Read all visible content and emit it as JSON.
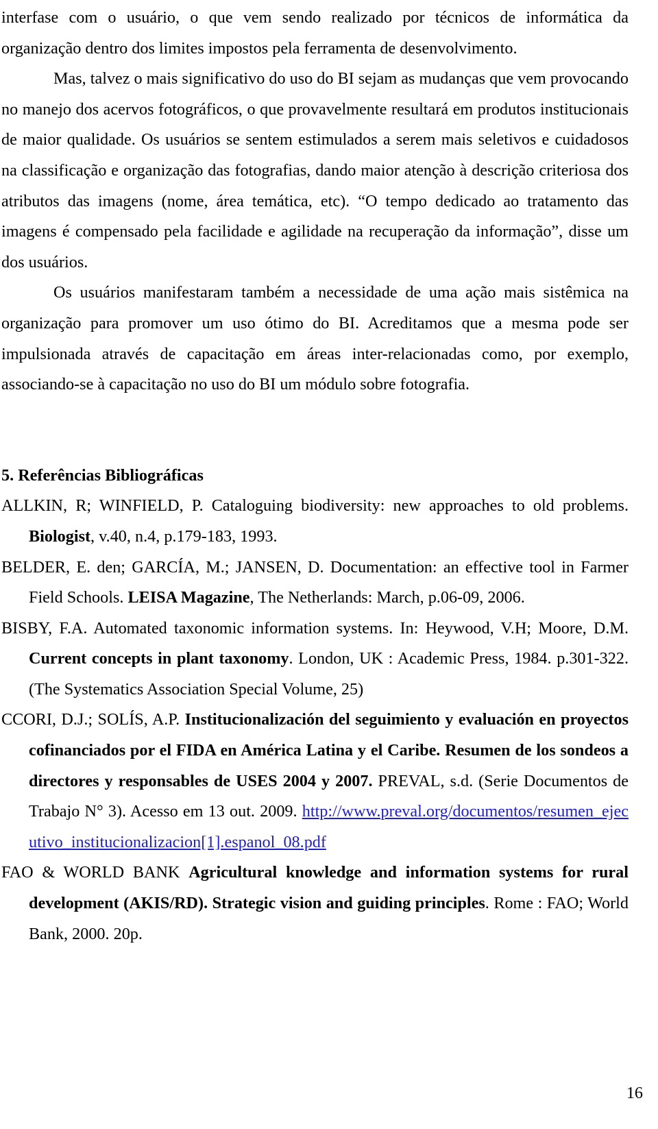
{
  "document": {
    "page_number": "16",
    "link_color": "#2020C8",
    "text_color": "#000000",
    "background_color": "#ffffff"
  },
  "body": {
    "paragraphs": [
      {
        "id": "p-interfase",
        "indent": false,
        "text": "interfase com o usuário, o que vem sendo realizado por técnicos de informática da organização dentro dos limites impostos pela ferramenta de desenvolvimento."
      },
      {
        "id": "p-mas-talvez",
        "indent": true,
        "text": "Mas, talvez o mais significativo do uso do BI sejam as mudanças que vem provocando no manejo dos acervos fotográficos, o que provavelmente resultará em produtos institucionais de maior qualidade. Os usuários se sentem estimulados a serem mais seletivos e cuidadosos na classificação e organização das fotografias, dando maior atenção à descrição criteriosa dos atributos das imagens (nome, área temática, etc). “O tempo dedicado ao tratamento das imagens é compensado pela facilidade e agilidade na recuperação da informação”, disse um dos usuários."
      },
      {
        "id": "p-os-usuarios",
        "indent": true,
        "text": "Os usuários manifestaram também a necessidade de uma ação mais sistêmica na organização para promover um uso ótimo do BI. Acreditamos que a mesma pode ser impulsionada através de capacitação em áreas inter-relacionadas como, por exemplo, associando-se à capacitação no uso do BI um módulo sobre fotografia."
      }
    ]
  },
  "references_section": {
    "heading": "5. Referências Bibliográficas",
    "entries": [
      {
        "id": "ref-allkin",
        "parts": [
          {
            "text": "ALLKIN, R; WINFIELD, P.   Cataloguing biodiversity: new approaches to old problems. ",
            "style": "normal"
          },
          {
            "text": "Biologist",
            "style": "bold"
          },
          {
            "text": ", v.40, n.4, p.179-183, 1993.",
            "style": "normal"
          }
        ]
      },
      {
        "id": "ref-belder",
        "parts": [
          {
            "text": "BELDER, E. den; GARCÍA, M.; JANSEN, D.   Documentation: an effective tool in Farmer Field Schools. ",
            "style": "normal"
          },
          {
            "text": "LEISA Magazine",
            "style": "bold"
          },
          {
            "text": ", The Netherlands: March, p.06-09, 2006.",
            "style": "normal"
          }
        ]
      },
      {
        "id": "ref-bisby",
        "parts": [
          {
            "text": "BISBY, F.A.   Automated taxonomic information systems. In: Heywood, V.H; Moore, D.M.  ",
            "style": "normal"
          },
          {
            "text": "Current concepts in plant taxonomy",
            "style": "bold"
          },
          {
            "text": ". London, UK : Academic Press, 1984. p.301-322. (The Systematics Association Special Volume, 25)",
            "style": "normal"
          }
        ]
      },
      {
        "id": "ref-ccori",
        "parts": [
          {
            "text": "CCORI, D.J.; SOLÍS, A.P.   ",
            "style": "normal"
          },
          {
            "text": "Institucionalización del seguimiento y evaluación en proyectos cofinanciados por el FIDA en América Latina y el Caribe. Resumen de los sondeos a directores y responsables de USES 2004 y 2007.",
            "style": "bold"
          },
          {
            "text": " PREVAL, s.d. (Serie Documentos de Trabajo N° 3). Acesso em 13 out. 2009. ",
            "style": "normal"
          },
          {
            "text": "http://www.preval.org/documentos/resumen_ejecutivo_institucionalizacion[1].espanol_08.pdf",
            "style": "link"
          }
        ]
      },
      {
        "id": "ref-fao-worldbank",
        "parts": [
          {
            "text": "FAO & WORLD BANK  ",
            "style": "normal"
          },
          {
            "text": "Agricultural knowledge and information systems for rural development (AKIS/RD). Strategic vision and guiding principles",
            "style": "bold"
          },
          {
            "text": ". Rome : FAO; World Bank, 2000. 20p.",
            "style": "normal"
          }
        ]
      }
    ]
  }
}
